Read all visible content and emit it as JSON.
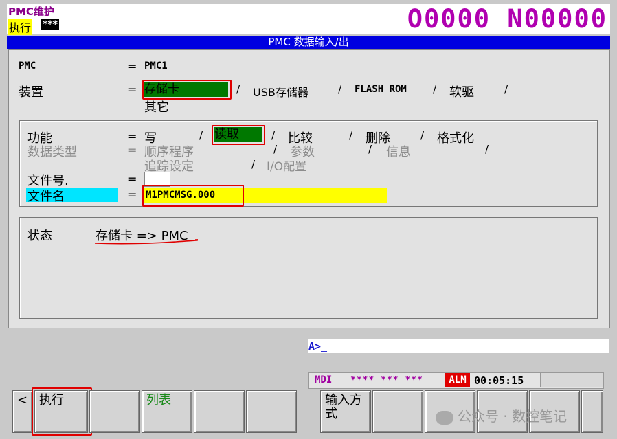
{
  "header": {
    "mode_title": "PMC维护",
    "exec_label": "执行",
    "exec_stars": "***",
    "program_number": "O0000 N00000"
  },
  "title_bar": "PMC 数据输入/出",
  "form": {
    "pmc_label": "PMC",
    "pmc_eq": "=",
    "pmc_value": "PMC1",
    "device_label": "装置",
    "device_eq": "=",
    "device_options": [
      "存储卡",
      "USB存储器",
      "FLASH ROM",
      "软驱",
      "其它"
    ],
    "device_selected": "存储卡",
    "function_label": "功能",
    "function_eq": "=",
    "function_options": [
      "写",
      "读取",
      "比较",
      "删除",
      "格式化"
    ],
    "function_selected": "读取",
    "data_type_label": "数据类型",
    "data_type_eq": "=",
    "data_type_options": [
      "顺序程序",
      "参数",
      "信息",
      "追踪设定",
      "I/O配置"
    ],
    "file_number_label": "文件号.",
    "file_number_eq": "=",
    "file_number_value": "",
    "file_name_label": "文件名",
    "file_name_eq": "=",
    "file_name_value": "M1PMCMSG.000"
  },
  "status": {
    "label": "状态",
    "value": "存储卡 => PMC"
  },
  "input_line": "A>_",
  "status_strip": {
    "mode": "MDI",
    "stars": "**** *** ***",
    "alarm": "ALM",
    "time": "00:05:15"
  },
  "softkeys": {
    "back": "<",
    "execute": "执行",
    "list": "列表",
    "input_method": "输入方式"
  },
  "watermark": "公众号 · 数控笔记",
  "colors": {
    "title_bar": "#0000e0",
    "selected_option": "#007800",
    "highlight_red": "#e00000",
    "file_name_field": "#ffff00",
    "label_highlight": "#00e5ff",
    "program_number": "#b000b0"
  }
}
